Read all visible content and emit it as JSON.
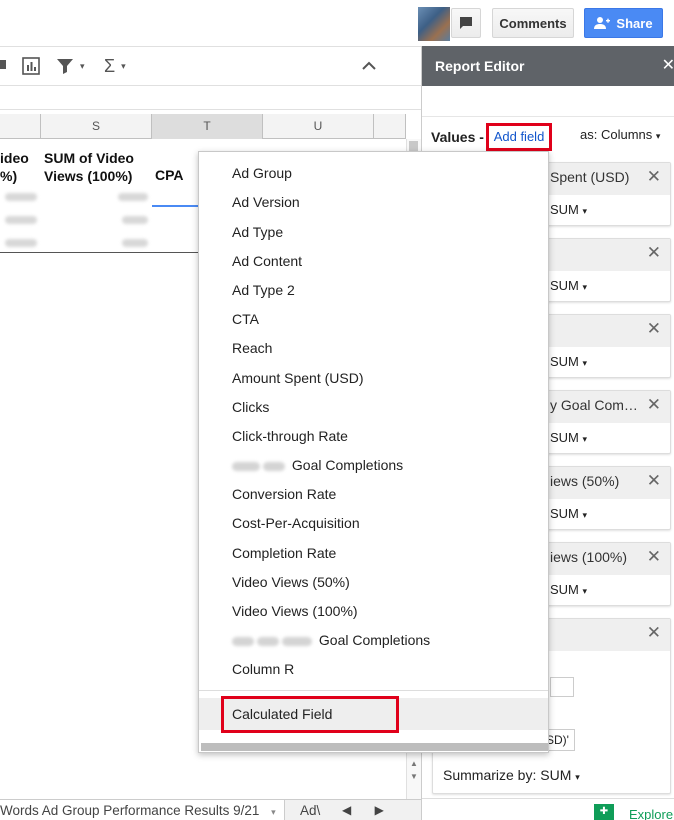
{
  "topbar": {
    "comments_label": "Comments",
    "share_label": "Share"
  },
  "columns": [
    "S",
    "T",
    "U"
  ],
  "grid": {
    "header_left": "ideo\n%)",
    "header_s": "SUM of Video\nViews (100%)",
    "header_t": "CPA"
  },
  "sheet_tabs": {
    "tab1": "Words Ad Group Performance Results 9/21",
    "tab2": "Ad\\"
  },
  "editor": {
    "title": "Report Editor",
    "values_label": "Values",
    "add_field_label": "Add field",
    "as_label": "as: Columns",
    "cards": [
      {
        "title": "Spent (USD)",
        "sum": "SUM"
      },
      {
        "title": "",
        "sum": "SUM"
      },
      {
        "title": "",
        "sum": "SUM"
      },
      {
        "title": "y Goal Com…",
        "sum": "SUM"
      },
      {
        "title": "iews (50%)",
        "sum": "SUM"
      },
      {
        "title": "iews (100%)",
        "sum": "SUM"
      }
    ],
    "formula_partial": "SD)'",
    "summarize_label": "Summarize by: SUM",
    "explore_label": "Explore"
  },
  "menu": {
    "items": [
      "Ad Group",
      "Ad Version",
      "Ad Type",
      "Ad Content",
      "Ad Type 2",
      "CTA",
      "Reach",
      "Amount Spent (USD)",
      "Clicks",
      "Click-through Rate",
      "Goal Completions",
      "Conversion Rate",
      "Cost-Per-Acquisition",
      "Completion Rate",
      "Video Views (50%)",
      "Video Views (100%)",
      "Goal Completions",
      "Column R"
    ],
    "calculated_field": "Calculated Field"
  }
}
